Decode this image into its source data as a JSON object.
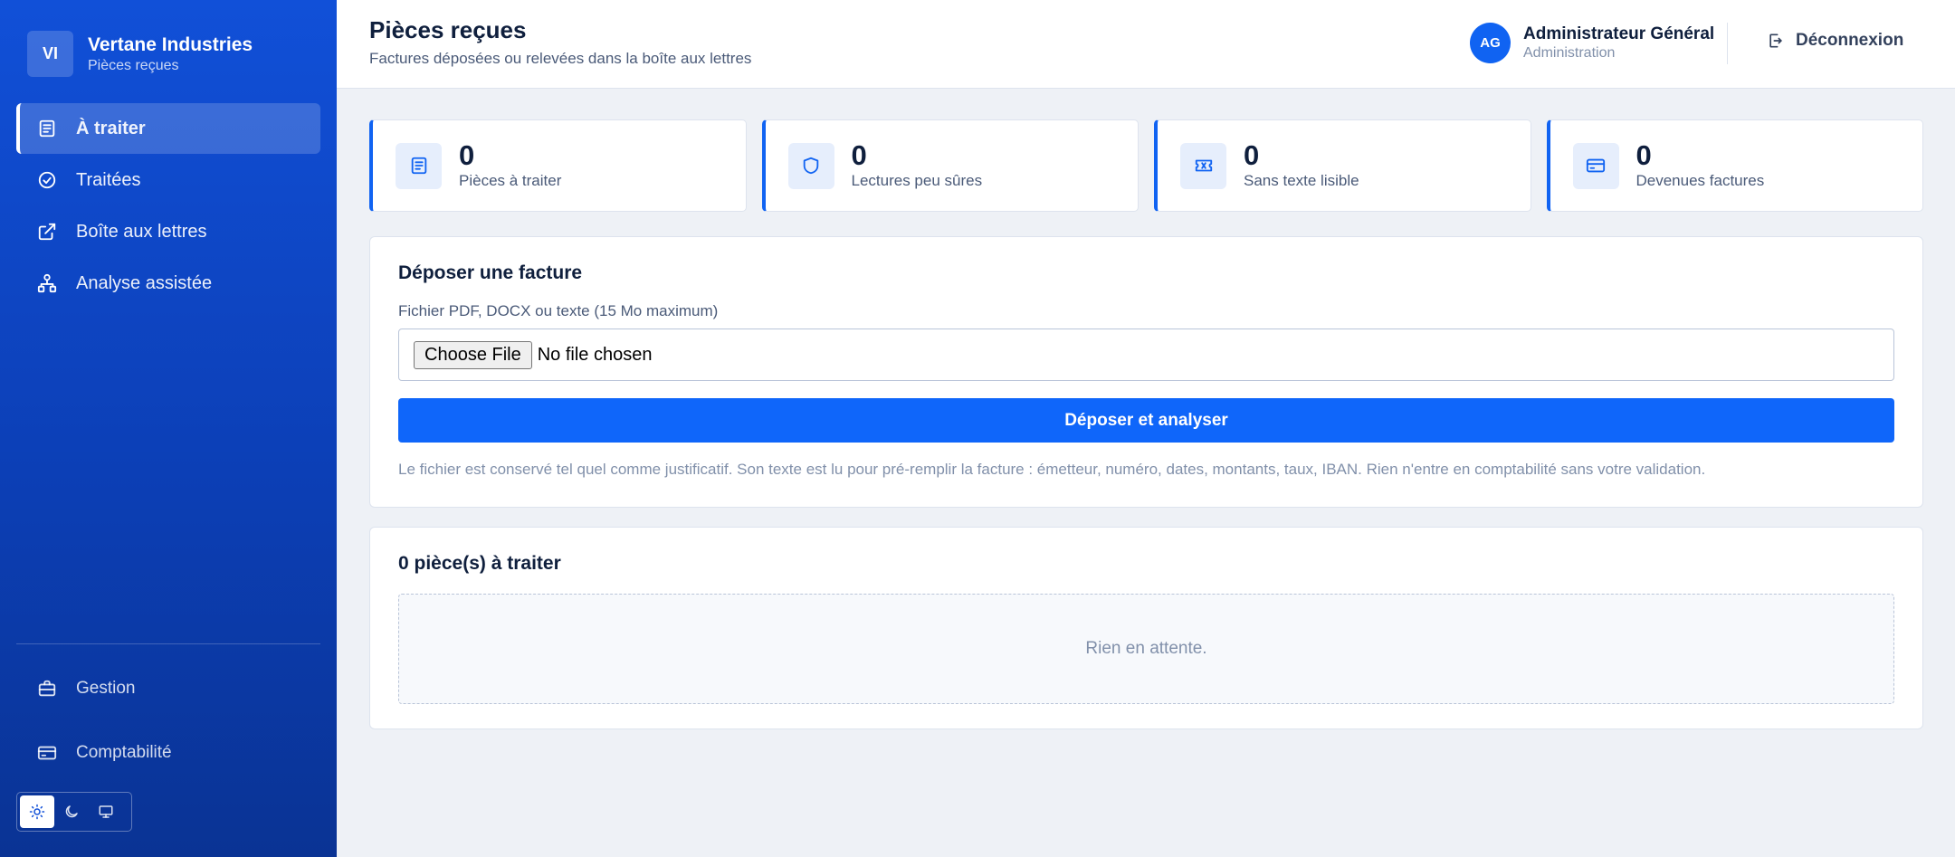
{
  "brand": {
    "initials": "VI",
    "name": "Vertane Industries",
    "subtitle": "Pièces reçues"
  },
  "sidebar": {
    "items": [
      {
        "label": "À traiter",
        "icon": "document-icon",
        "active": true
      },
      {
        "label": "Traitées",
        "icon": "check-circle-icon",
        "active": false
      },
      {
        "label": "Boîte aux lettres",
        "icon": "external-link-icon",
        "active": false
      },
      {
        "label": "Analyse assistée",
        "icon": "sitemap-icon",
        "active": false
      }
    ],
    "bottom_items": [
      {
        "label": "Gestion",
        "icon": "briefcase-icon"
      },
      {
        "label": "Comptabilité",
        "icon": "credit-card-icon"
      }
    ],
    "theme_options": [
      "sun-icon",
      "moon-icon",
      "monitor-icon"
    ],
    "theme_selected": "sun-icon"
  },
  "header": {
    "title": "Pièces reçues",
    "subtitle": "Factures déposées ou relevées dans la boîte aux lettres",
    "user": {
      "initials": "AG",
      "name": "Administrateur Général",
      "role": "Administration"
    },
    "logout_label": "Déconnexion"
  },
  "stats": [
    {
      "value": "0",
      "label": "Pièces à traiter",
      "icon": "document-icon"
    },
    {
      "value": "0",
      "label": "Lectures peu sûres",
      "icon": "shield-icon"
    },
    {
      "value": "0",
      "label": "Sans texte lisible",
      "icon": "ticket-icon"
    },
    {
      "value": "0",
      "label": "Devenues factures",
      "icon": "credit-card-icon"
    }
  ],
  "upload": {
    "title": "Déposer une facture",
    "field_label": "Fichier PDF, DOCX ou texte (15 Mo maximum)",
    "file_button": "Choose File",
    "file_status": "No file chosen",
    "submit_label": "Déposer et analyser",
    "note": "Le fichier est conservé tel quel comme justificatif. Son texte est lu pour pré-remplir la facture : émetteur, numéro, dates, montants, taux, IBAN. Rien n'entre en comptabilité sans votre validation."
  },
  "queue": {
    "title": "0 pièce(s) à traiter",
    "empty_text": "Rien en attente."
  },
  "colors": {
    "accent": "#0f66fa",
    "sidebar_top": "#1150d8",
    "sidebar_bottom": "#0a3394"
  }
}
